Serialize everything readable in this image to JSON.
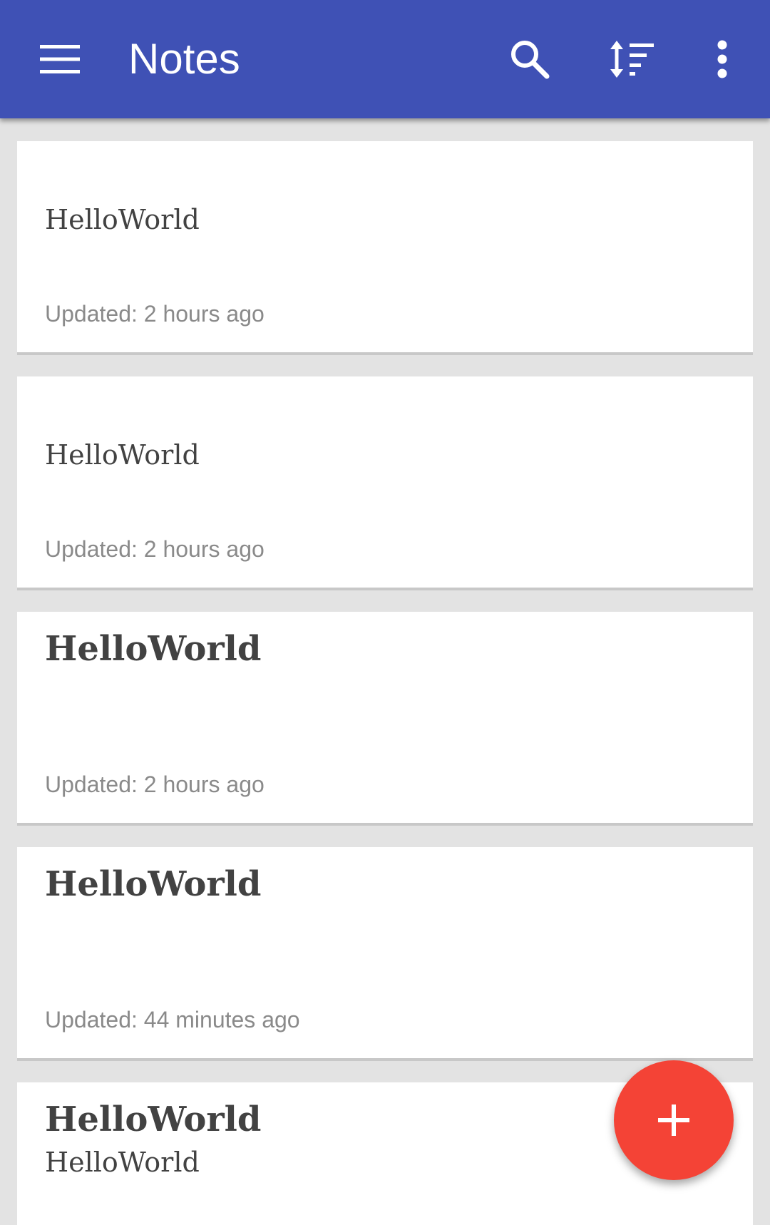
{
  "app_bar": {
    "title": "Notes",
    "menu_icon": "menu-icon",
    "search_icon": "search-icon",
    "sort_icon": "sort-icon",
    "overflow_icon": "more-vert-icon",
    "color": "#3f51b5"
  },
  "notes": [
    {
      "title": "",
      "body": "HelloWorld",
      "updated": "Updated: 2 hours ago"
    },
    {
      "title": "",
      "body": "HelloWorld",
      "updated": "Updated: 2 hours ago"
    },
    {
      "title": "HelloWorld",
      "body": "",
      "updated": "Updated: 2 hours ago"
    },
    {
      "title": "HelloWorld",
      "body": "",
      "updated": "Updated: 44 minutes ago"
    },
    {
      "title": "HelloWorld",
      "body": "HelloWorld",
      "updated": ""
    }
  ],
  "fab": {
    "icon": "add-icon",
    "color": "#f44336"
  }
}
